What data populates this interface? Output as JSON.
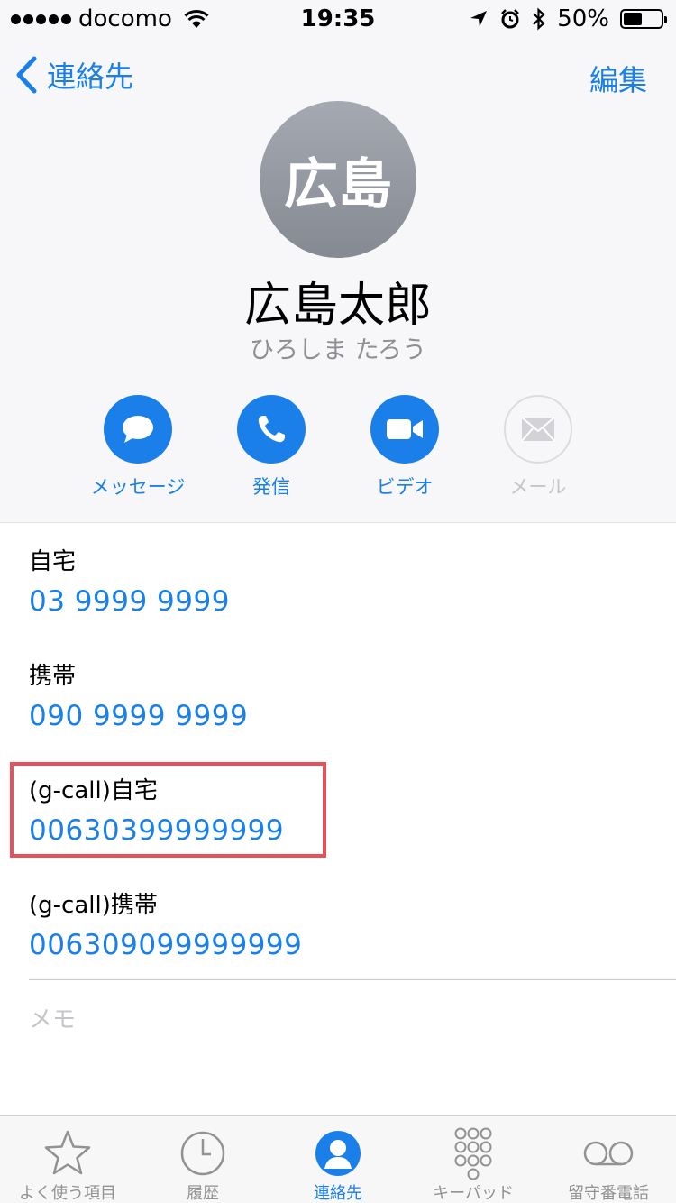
{
  "status_bar": {
    "carrier": "docomo",
    "time": "19:35",
    "battery": "50%",
    "battery_level": 0.5
  },
  "nav": {
    "back_label": "連絡先",
    "edit_label": "編集"
  },
  "contact": {
    "avatar_text": "広島",
    "name": "広島太郎",
    "kana": "ひろしま たろう"
  },
  "actions": [
    {
      "label": "メッセージ",
      "icon": "message-icon",
      "enabled": true
    },
    {
      "label": "発信",
      "icon": "phone-icon",
      "enabled": true
    },
    {
      "label": "ビデオ",
      "icon": "video-icon",
      "enabled": true
    },
    {
      "label": "メール",
      "icon": "mail-icon",
      "enabled": false
    }
  ],
  "entries": [
    {
      "label": "自宅",
      "value": "03 9999 9999"
    },
    {
      "label": "携帯",
      "value": "090 9999 9999"
    },
    {
      "label": "(g-call)自宅",
      "value": "0063039999999​9"
    },
    {
      "label": "(g-call)携帯",
      "value": "006309099999999"
    }
  ],
  "memo": {
    "placeholder": "メモ"
  },
  "tab_bar": {
    "items": [
      {
        "label": "よく使う項目",
        "icon": "star-icon"
      },
      {
        "label": "履歴",
        "icon": "clock-icon"
      },
      {
        "label": "連絡先",
        "icon": "contacts-icon",
        "active": true
      },
      {
        "label": "キーパッド",
        "icon": "keypad-icon"
      },
      {
        "label": "留守番電話",
        "icon": "voicemail-icon"
      }
    ]
  },
  "colors": {
    "accent": "#1a7fe8",
    "highlight": "#e8505b"
  }
}
